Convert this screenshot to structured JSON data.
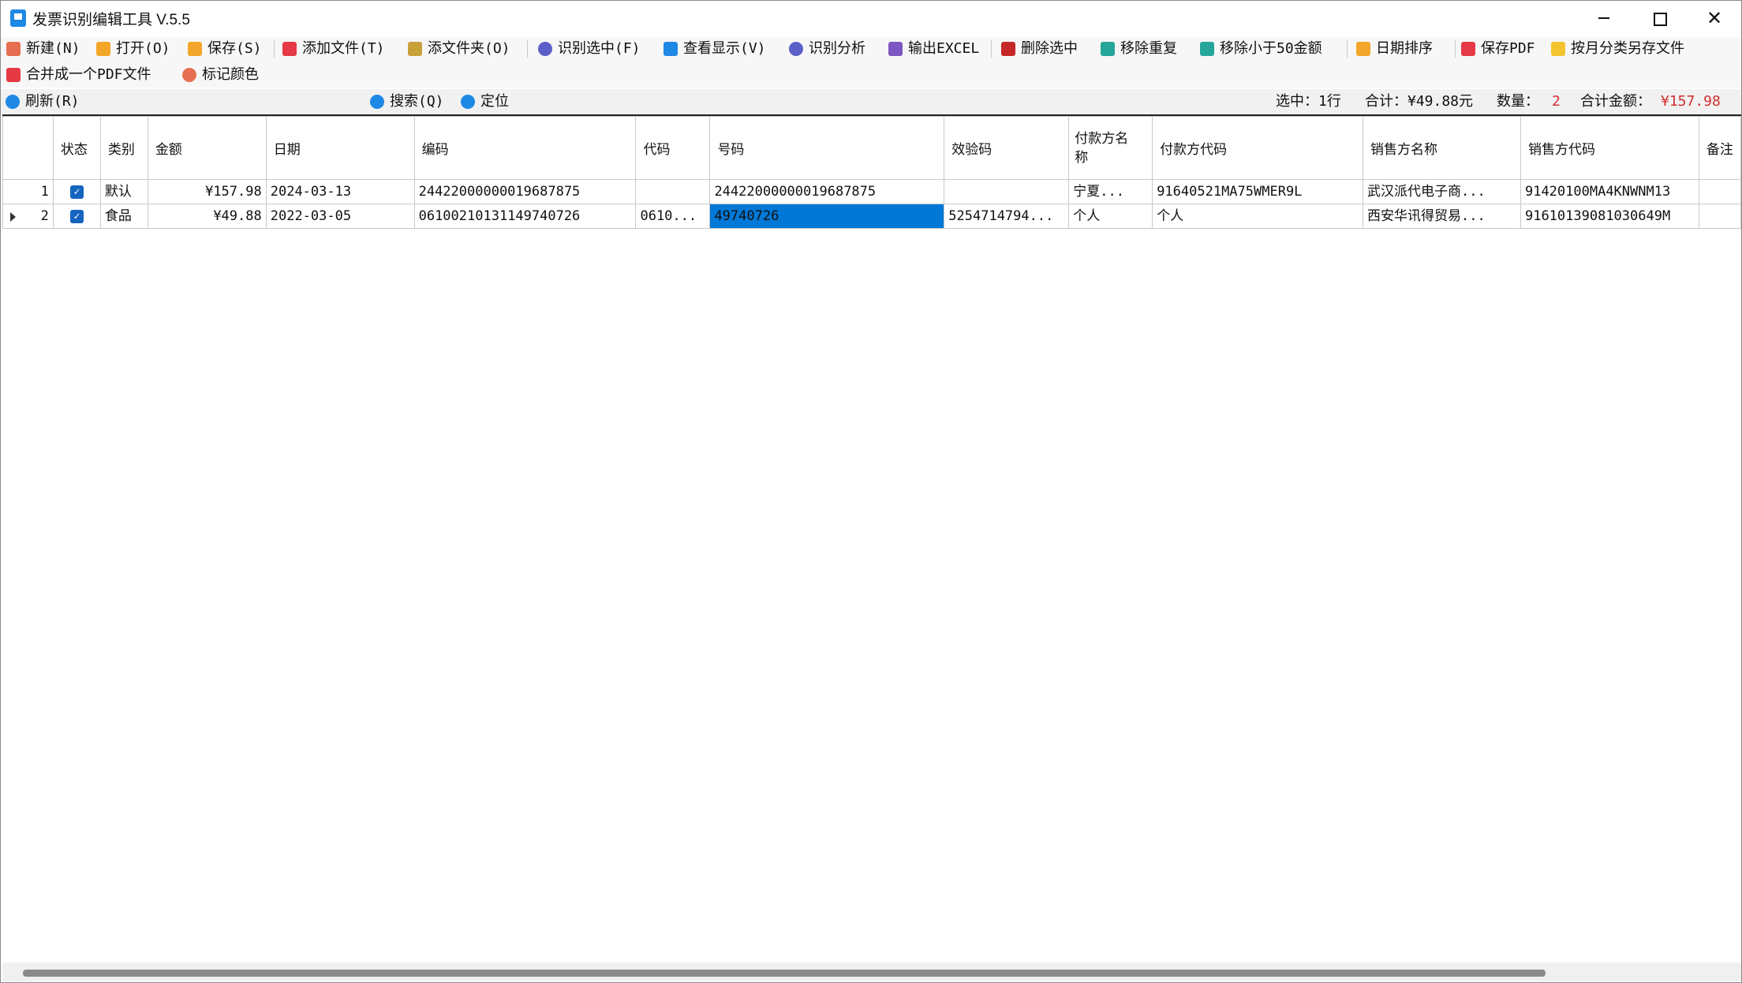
{
  "window": {
    "title": "发票识别编辑工具 V.5.5"
  },
  "toolbar": {
    "row1": [
      {
        "label": "新建(N)",
        "icon": "new-doc-icon",
        "color": "#e76f51"
      },
      {
        "label": "打开(O)",
        "icon": "folder-open-icon",
        "color": "#f4a62a"
      },
      {
        "label": "保存(S)",
        "icon": "save-icon",
        "color": "#f4a62a"
      },
      {
        "label": "添加文件(T)",
        "icon": "pdf-add-icon",
        "color": "#e53945"
      },
      {
        "label": "添文件夹(O)",
        "icon": "folder-add-icon",
        "color": "#c9a13a"
      },
      {
        "label": "识别选中(F)",
        "icon": "recognize-icon",
        "color": "#5b5fc7"
      },
      {
        "label": "查看显示(V)",
        "icon": "list-view-icon",
        "color": "#1e88e5"
      },
      {
        "label": "识别分析",
        "icon": "analyze-icon",
        "color": "#5b5fc7"
      },
      {
        "label": "输出EXCEL",
        "icon": "excel-export-icon",
        "color": "#7e57c2"
      },
      {
        "label": "删除选中",
        "icon": "trash-icon",
        "color": "#c62828"
      },
      {
        "label": "移除重复",
        "icon": "remove-duplicate-icon",
        "color": "#26a69a"
      },
      {
        "label": "移除小于50金额",
        "icon": "remove-small-icon",
        "color": "#26a69a"
      },
      {
        "label": "日期排序",
        "icon": "date-sort-icon",
        "color": "#f4a62a"
      },
      {
        "label": "保存PDF",
        "icon": "save-pdf-icon",
        "color": "#e53945"
      },
      {
        "label": "按月分类另存文件",
        "icon": "folder-month-icon",
        "color": "#f4c430"
      }
    ],
    "row2": [
      {
        "label": "合并成一个PDF文件",
        "icon": "pdf-merge-icon",
        "color": "#e53945"
      },
      {
        "label": "标记颜色",
        "icon": "palette-icon",
        "color": "#e76f51"
      }
    ]
  },
  "subbar": {
    "refresh": "刷新(R)",
    "search": "搜索(Q)",
    "locate": "定位",
    "selected_label": "选中：",
    "selected_value": "1行",
    "sum_label": "合计：",
    "sum_value": "¥49.88元",
    "count_label": "数量：",
    "count_value": "2",
    "total_label": "合计金额：",
    "total_value": "¥157.98"
  },
  "table": {
    "columns": [
      "",
      "状态",
      "类别",
      "金额",
      "日期",
      "编码",
      "代码",
      "号码",
      "效验码",
      "付款方名称",
      "付款方代码",
      "销售方名称",
      "销售方代码",
      "备注"
    ],
    "rows": [
      {
        "num": "1",
        "checked": "✓",
        "category": "默认",
        "amount": "¥157.98",
        "date": "2024-03-13",
        "code_full": "24422000000019687875",
        "code": "",
        "number": "24422000000019687875",
        "check": "",
        "payer": "宁夏...",
        "payer_code": "91640521MA75WMER9L",
        "seller": "武汉派代电子商...",
        "seller_code": "91420100MA4KNWNM13",
        "note": ""
      },
      {
        "num": "2",
        "checked": "✓",
        "category": "食品",
        "amount": "¥49.88",
        "date": "2022-03-05",
        "code_full": "06100210131149740726",
        "code": "0610...",
        "number": "49740726",
        "check": "5254714794...",
        "payer": "个人",
        "payer_code": "个人",
        "seller": "西安华讯得贸易...",
        "seller_code": "91610139081030649M",
        "note": ""
      }
    ]
  }
}
